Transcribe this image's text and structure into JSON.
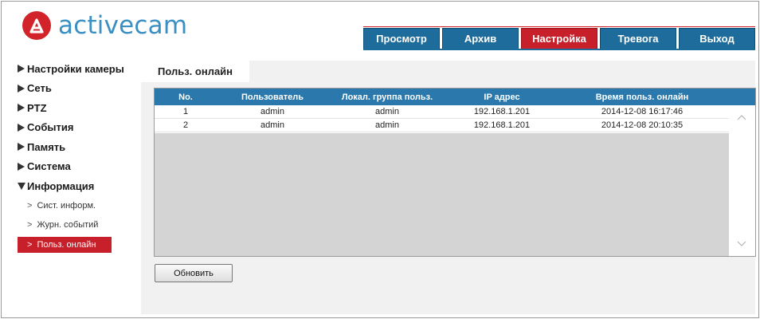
{
  "brand": {
    "name": "activecam",
    "logo_color": "#d2232a",
    "text_color": "#3a8fc3"
  },
  "nav": {
    "tabs": [
      {
        "label": "Просмотр",
        "active": false
      },
      {
        "label": "Архив",
        "active": false
      },
      {
        "label": "Настройка",
        "active": true
      },
      {
        "label": "Тревога",
        "active": false
      },
      {
        "label": "Выход",
        "active": false
      }
    ],
    "accent_active": "#c8202a",
    "accent_inactive": "#1d6c9b"
  },
  "sidebar": {
    "items": [
      {
        "label": "Настройки камеры",
        "expanded": false
      },
      {
        "label": "Сеть",
        "expanded": false
      },
      {
        "label": "PTZ",
        "expanded": false
      },
      {
        "label": "События",
        "expanded": false
      },
      {
        "label": "Память",
        "expanded": false
      },
      {
        "label": "Система",
        "expanded": false
      },
      {
        "label": "Информация",
        "expanded": true
      }
    ],
    "subitems": [
      {
        "label": "Сист. информ.",
        "active": false
      },
      {
        "label": "Журн. событий",
        "active": false
      },
      {
        "label": "Польз. онлайн",
        "active": true
      }
    ]
  },
  "content": {
    "tab_title": "Польз. онлайн",
    "table": {
      "headers": [
        "No.",
        "Пользователь",
        "Локал. группа польз.",
        "IP адрес",
        "Время польз. онлайн"
      ],
      "rows": [
        [
          "1",
          "admin",
          "admin",
          "192.168.1.201",
          "2014-12-08 16:17:46"
        ],
        [
          "2",
          "admin",
          "admin",
          "192.168.1.201",
          "2014-12-08 20:10:35"
        ]
      ]
    },
    "refresh_label": "Обновить"
  }
}
